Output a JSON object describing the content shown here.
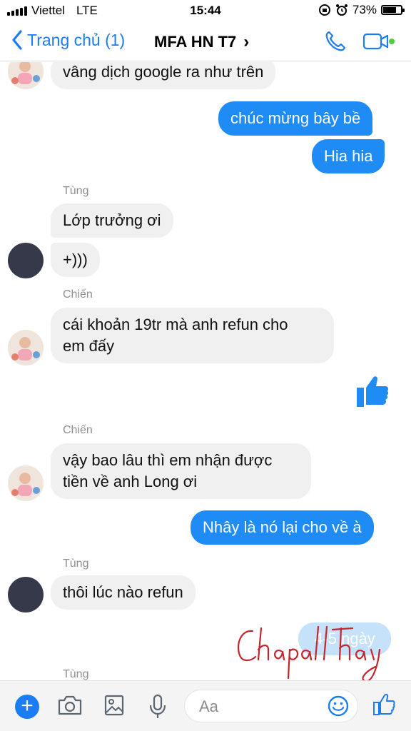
{
  "status_bar": {
    "carrier": "Viettel",
    "network": "LTE",
    "time": "15:44",
    "battery": "73%",
    "battery_level": 0.73
  },
  "header": {
    "back_label": "Trang chủ (1)",
    "title": "MFA HN T7",
    "title_chevron": "›",
    "icons": [
      "chevron-left-icon",
      "phone-icon",
      "video-camera-icon"
    ],
    "accent": "#1b7cf5",
    "online": true
  },
  "messages": [
    {
      "side": "in",
      "text": "vâng dịch google ra như trên"
    },
    {
      "side": "out",
      "text": "chúc mừng bây bề"
    },
    {
      "side": "out",
      "text": "Hia hia"
    },
    {
      "side": "in",
      "sender": "Tùng",
      "text": "Lớp trưởng  ơi"
    },
    {
      "side": "in",
      "text": "+)))"
    },
    {
      "side": "in",
      "sender": "Chiến",
      "text": "cái khoản 19tr mà anh refun cho em đấy"
    },
    {
      "side": "out",
      "type": "like"
    },
    {
      "side": "in",
      "sender": "Chiến",
      "text": "vậy bao lâu thì em nhận được tiền về anh Long ơi"
    },
    {
      "side": "out",
      "text": "Nhây là nó lại cho về à"
    },
    {
      "side": "in",
      "sender": "Tùng",
      "text": "thôi lúc nào refun"
    },
    {
      "side": "out",
      "text": "4-5 ngày"
    },
    {
      "side": "in",
      "sender": "Tùng",
      "text": ""
    }
  ],
  "bubble_lines": {
    "msg5_line1": "cái khoản 19tr mà anh refun cho",
    "msg5_line2": "em đấy",
    "msg7_line1": "vậy bao lâu thì em nhận được",
    "msg7_line2": "tiền về anh Long ơi"
  },
  "composer": {
    "placeholder": "Aa",
    "plus": "+",
    "icons": [
      "plus-icon",
      "camera-icon",
      "image-icon",
      "microphone-icon",
      "emoji-icon",
      "thumbs-up-icon"
    ]
  },
  "watermark": {
    "text": "ChapaLLthay",
    "color": "#c4262e"
  },
  "colors": {
    "outgoing": "#1f8cf5",
    "incoming": "#f0f0f0",
    "sender_label": "#8e8e8e"
  }
}
